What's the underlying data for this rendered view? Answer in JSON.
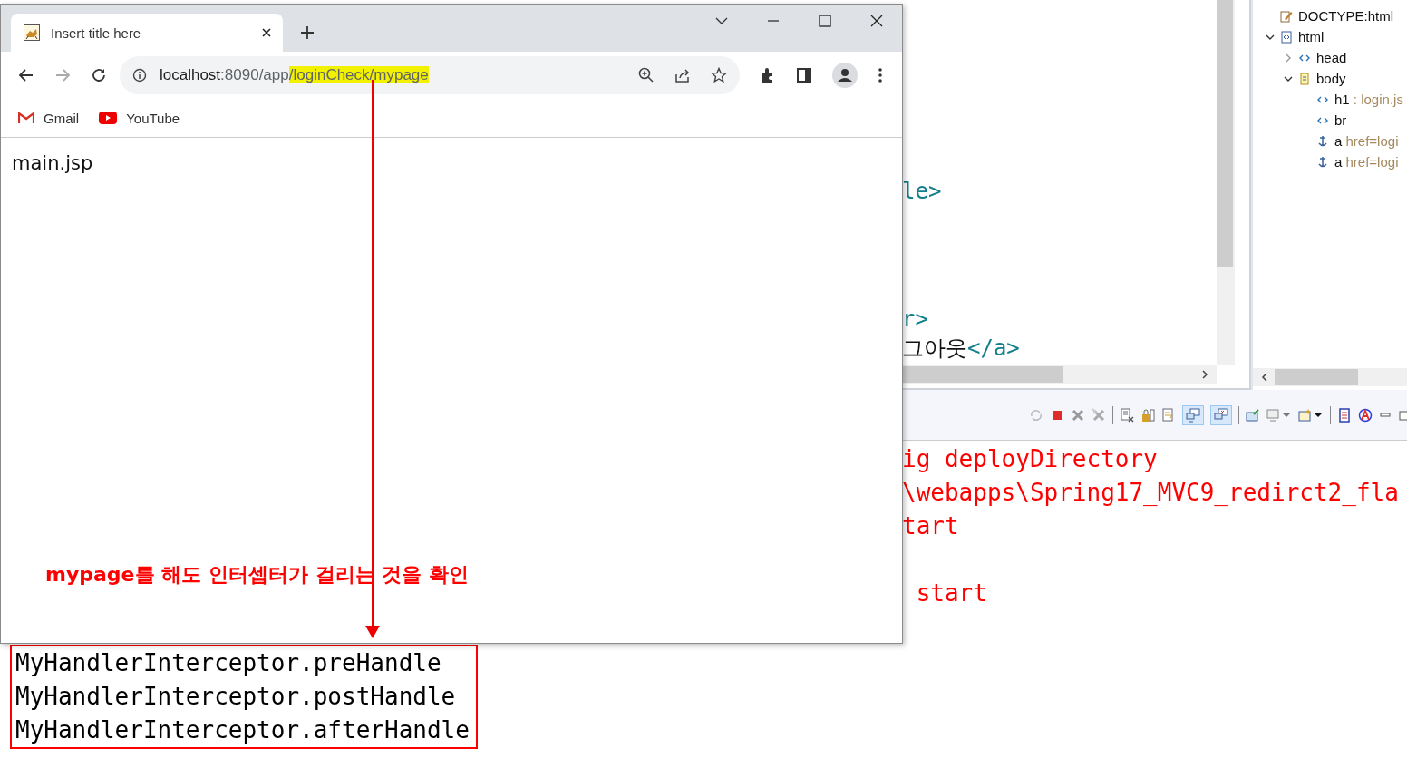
{
  "editor": {
    "code_lines": [
      [
        {
          "text": "le>",
          "kind": "tag"
        }
      ],
      [
        {
          "text": "r>",
          "kind": "tag"
        }
      ],
      [
        {
          "text": "그아웃",
          "kind": "text"
        },
        {
          "text": "</a>",
          "kind": "tag"
        }
      ]
    ]
  },
  "outline": {
    "items": [
      {
        "label": "DOCTYPE:html",
        "kind": "doctype"
      },
      {
        "label": "html",
        "kind": "html",
        "expanded": true,
        "children": [
          {
            "label": "head",
            "kind": "element",
            "expanded": false
          },
          {
            "label": "body",
            "kind": "body",
            "expanded": true,
            "children": [
              {
                "label": "h1",
                "detail": " : login.js",
                "kind": "element"
              },
              {
                "label": "br",
                "kind": "element"
              },
              {
                "label": "a",
                "detail": " href=logi",
                "kind": "anchor"
              },
              {
                "label": "a",
                "detail": " href=logi",
                "kind": "anchor"
              }
            ]
          }
        ]
      }
    ]
  },
  "console": {
    "lines": [
      "ig deployDirectory",
      "\\webapps\\Spring17_MVC9_redirct2_fla",
      "tart",
      " start"
    ],
    "output": [
      "MyHandlerInterceptor.preHandle",
      "MyHandlerInterceptor.postHandle",
      "MyHandlerInterceptor.afterHandle"
    ]
  },
  "browser": {
    "tab": {
      "title": "Insert title here",
      "selected": true
    },
    "address": {
      "host": "localhost",
      "rest": ":8090/app",
      "highlighted": "/loginCheck/mypage"
    },
    "bookmarks": [
      {
        "label": "Gmail",
        "kind": "gmail"
      },
      {
        "label": "YouTube",
        "kind": "youtube"
      }
    ],
    "page_text": "main.jsp"
  },
  "annotation": {
    "note": "mypage를 해도 인터셉터가 걸리는 것을 확인"
  }
}
